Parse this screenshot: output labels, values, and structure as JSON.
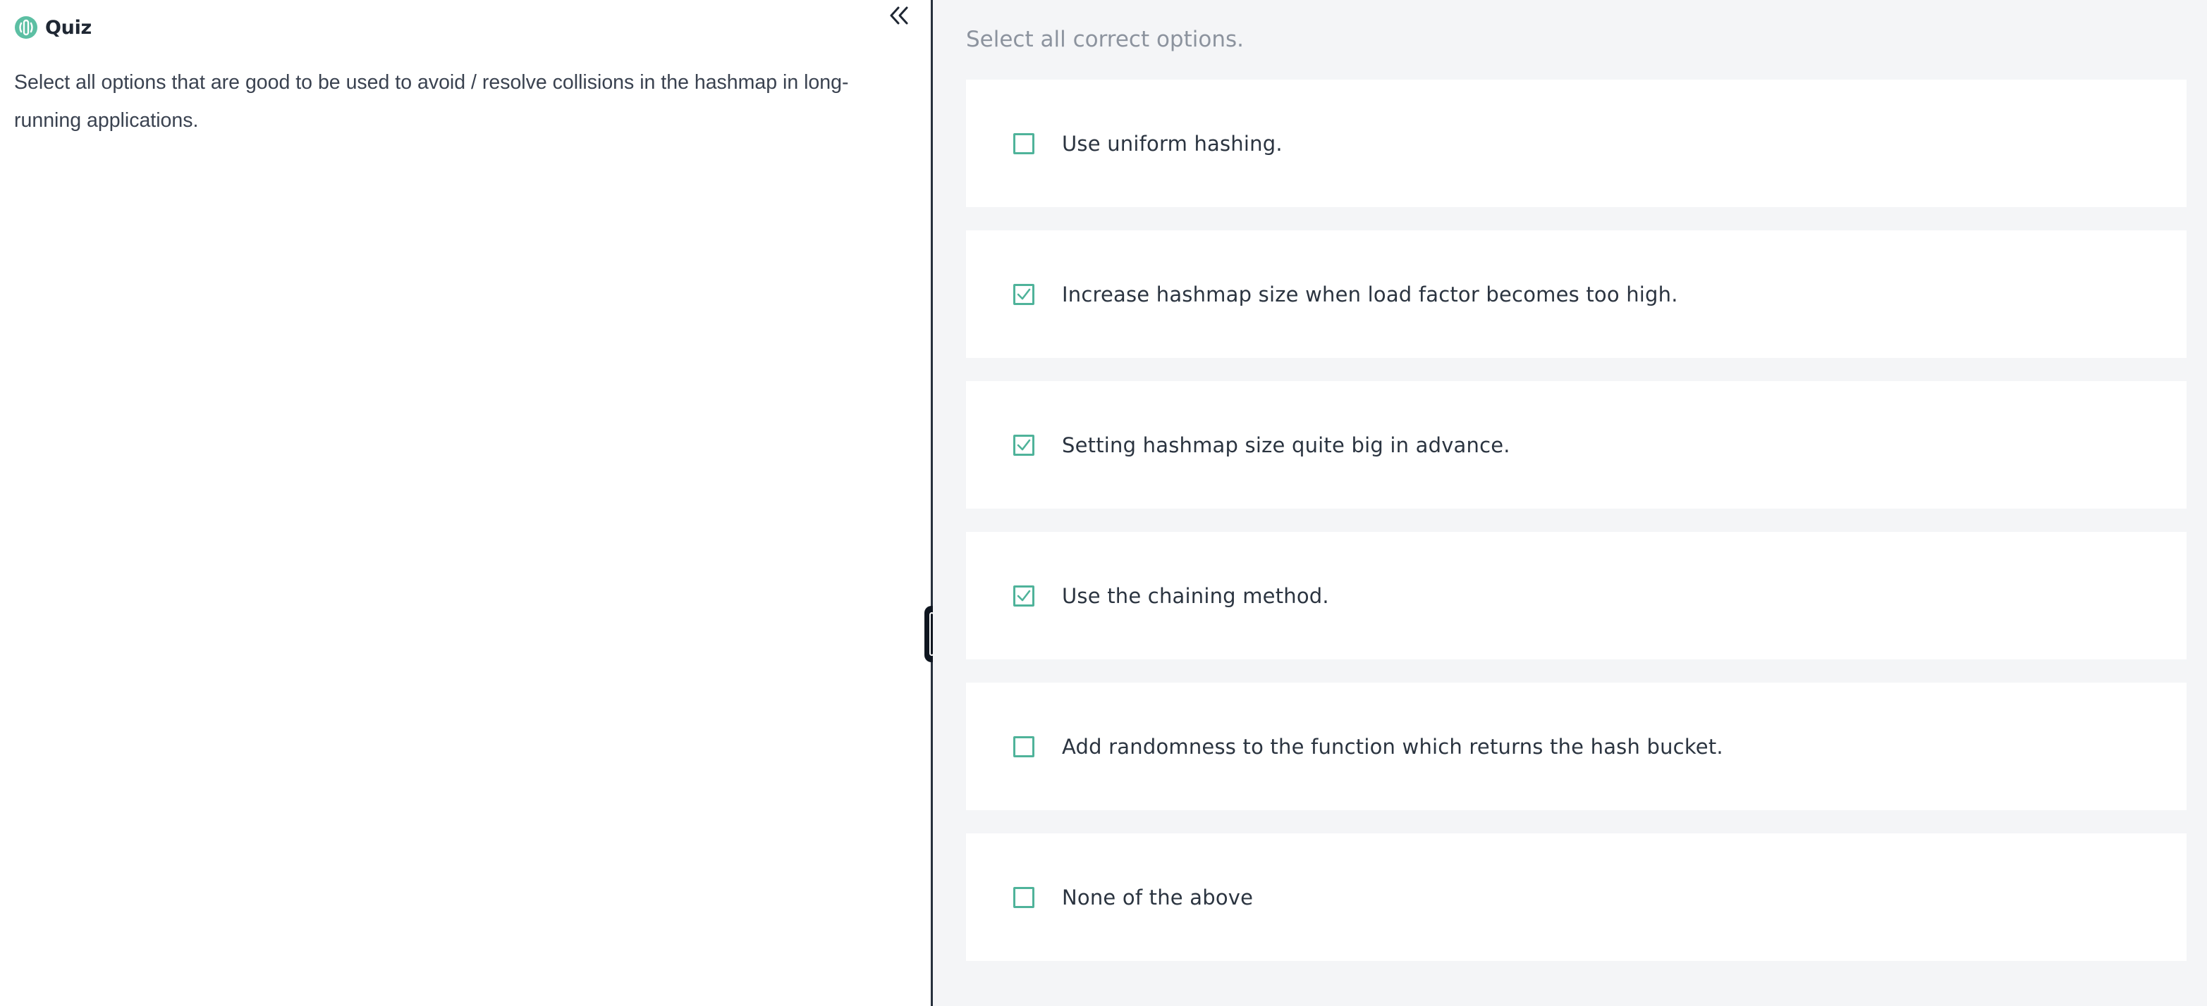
{
  "quiz": {
    "title": "Quiz",
    "icon": "quiz-icon",
    "question": "Select all options that are good to be used to avoid / resolve collisions in the hashmap in long-running applications."
  },
  "collapse": {
    "icon": "double-chevron-left-icon"
  },
  "instruction": "Select all correct options.",
  "options": [
    {
      "label": "Use uniform hashing.",
      "checked": false
    },
    {
      "label": "Increase hashmap size when load factor becomes too high.",
      "checked": true
    },
    {
      "label": "Setting hashmap size quite big in advance.",
      "checked": true
    },
    {
      "label": "Use the chaining method.",
      "checked": true
    },
    {
      "label": "Add randomness to the function which returns the hash bucket.",
      "checked": false
    },
    {
      "label": "None of the above",
      "checked": false
    }
  ],
  "colors": {
    "accent": "#4fb39a",
    "right_panel_bg": "#f4f5f7",
    "divider": "#27303d"
  }
}
